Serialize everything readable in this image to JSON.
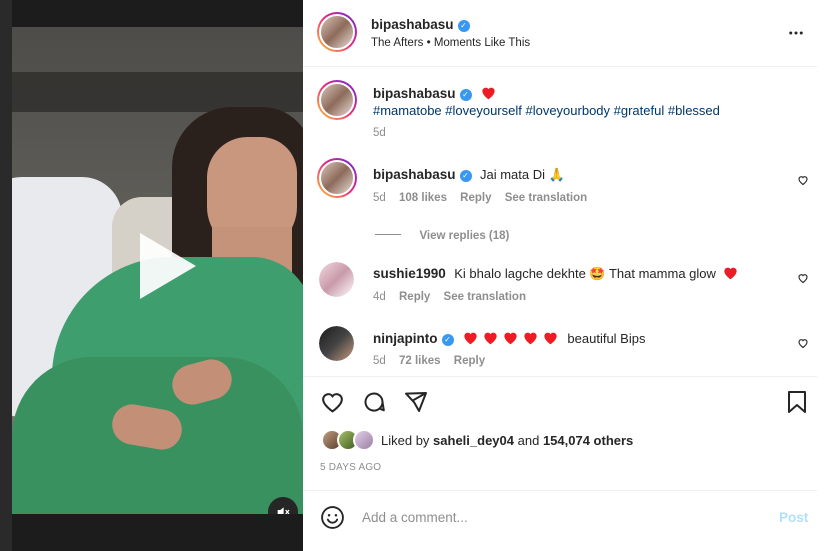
{
  "post": {
    "username": "bipashabasu",
    "subtitle": "The Afters • Moments Like This",
    "caption_hashtags": "#mamatobe #loveyourself #loveyourbody #grateful #blessed",
    "caption_time": "5d"
  },
  "comments": [
    {
      "username": "bipashabasu",
      "text": "Jai mata Di 🙏",
      "time": "5d",
      "likes": "108 likes",
      "reply": "Reply",
      "translate": "See translation",
      "view_replies": "View replies (18)"
    },
    {
      "username": "sushie1990",
      "text": "Ki bhalo lagche dekhte 🤩 That mamma glow",
      "time": "4d",
      "reply": "Reply",
      "translate": "See translation"
    },
    {
      "username": "ninjapinto",
      "text": "beautiful Bips",
      "time": "5d",
      "likes": "72 likes",
      "reply": "Reply"
    }
  ],
  "likes_line": {
    "prefix": "Liked by",
    "user": "saheli_dey04",
    "and": "and",
    "others": "154,074 others"
  },
  "date": "5 DAYS AGO",
  "comment_box": {
    "placeholder": "Add a comment...",
    "post_label": "Post"
  },
  "icons": {
    "more": "more-options-icon",
    "like": "heart-icon",
    "comment": "comment-icon",
    "share": "paper-plane-icon",
    "save": "bookmark-icon",
    "emoji": "emoji-icon",
    "mute": "muted-speaker-icon",
    "play": "play-icon"
  },
  "colors": {
    "verified": "#3897f0",
    "hashtag": "#00376b",
    "heart_red": "#ed4956",
    "post_disabled": "#b2dffc"
  }
}
